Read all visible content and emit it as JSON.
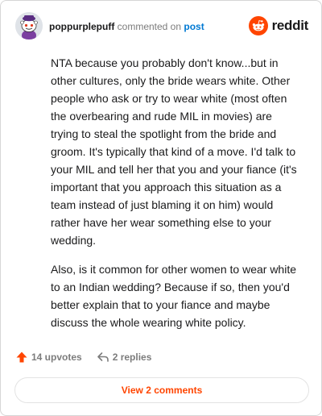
{
  "colors": {
    "accent": "#ff4500",
    "link": "#0079d3",
    "muted": "#7c7c7c",
    "text": "#1a1a1b"
  },
  "comment": {
    "username": "poppurplepuff",
    "action_text": "commented on",
    "target_link": "post",
    "brand": "reddit",
    "paragraphs": [
      "NTA because you probably don't know...but in other cultures, only the bride wears white. Other people who ask or try to wear white (most often the overbearing and rude MIL in movies) are trying to steal the spotlight from the bride and groom. It's typically that kind of a move. I'd talk to your MIL and tell her that you and your fiance (it's important that you approach this situation as a team instead of just blaming it on him) would rather have her wear something else to your wedding.",
      "Also, is it common for other women to wear white to an Indian wedding? Because if so, then you'd better explain that to your fiance and maybe discuss the whole wearing white policy."
    ]
  },
  "actions": {
    "upvotes_label": "14 upvotes",
    "replies_label": "2 replies"
  },
  "footer": {
    "view_comments_label": "View 2 comments"
  },
  "icons": {
    "avatar": "snoo-avatar-icon",
    "brand": "reddit-logo-icon",
    "upvote": "upvote-arrow-icon",
    "reply": "reply-arrow-icon"
  }
}
